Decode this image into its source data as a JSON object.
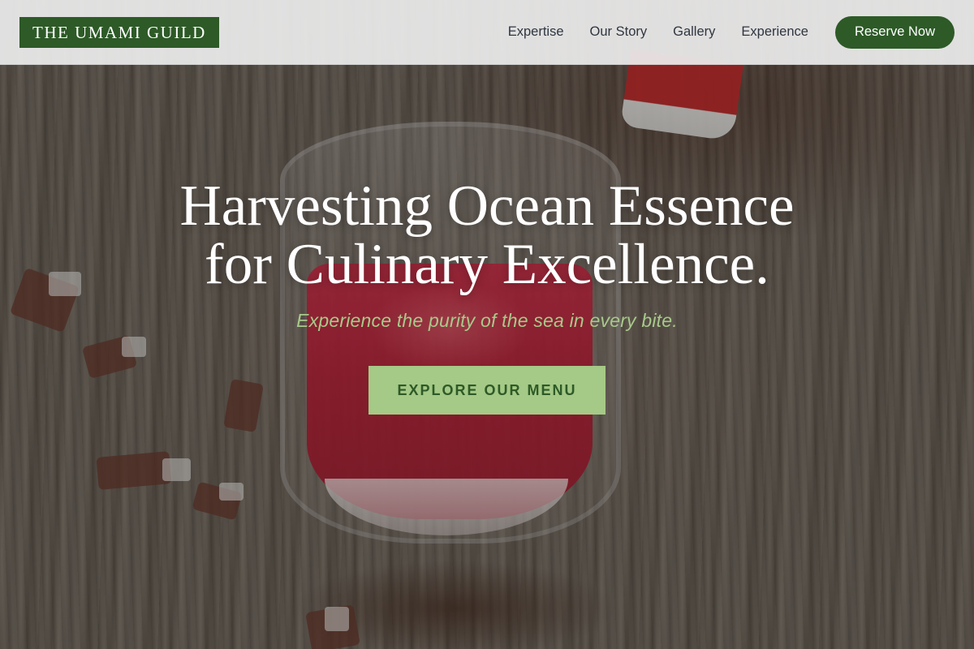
{
  "brand": {
    "logo_text": "THE UMAMI GUILD",
    "primary_color": "#2d5a27",
    "accent_color": "#a5c986"
  },
  "nav": {
    "links": [
      {
        "label": "Expertise"
      },
      {
        "label": "Our Story"
      },
      {
        "label": "Gallery"
      },
      {
        "label": "Experience"
      }
    ],
    "cta_label": "Reserve Now"
  },
  "hero": {
    "title": "Harvesting Ocean Essence for Culinary Excellence.",
    "subtitle": "Experience the purity of the sea in every bite.",
    "cta_label": "EXPLORE OUR MENU",
    "background_image": "red drink in glass on wooden table"
  }
}
